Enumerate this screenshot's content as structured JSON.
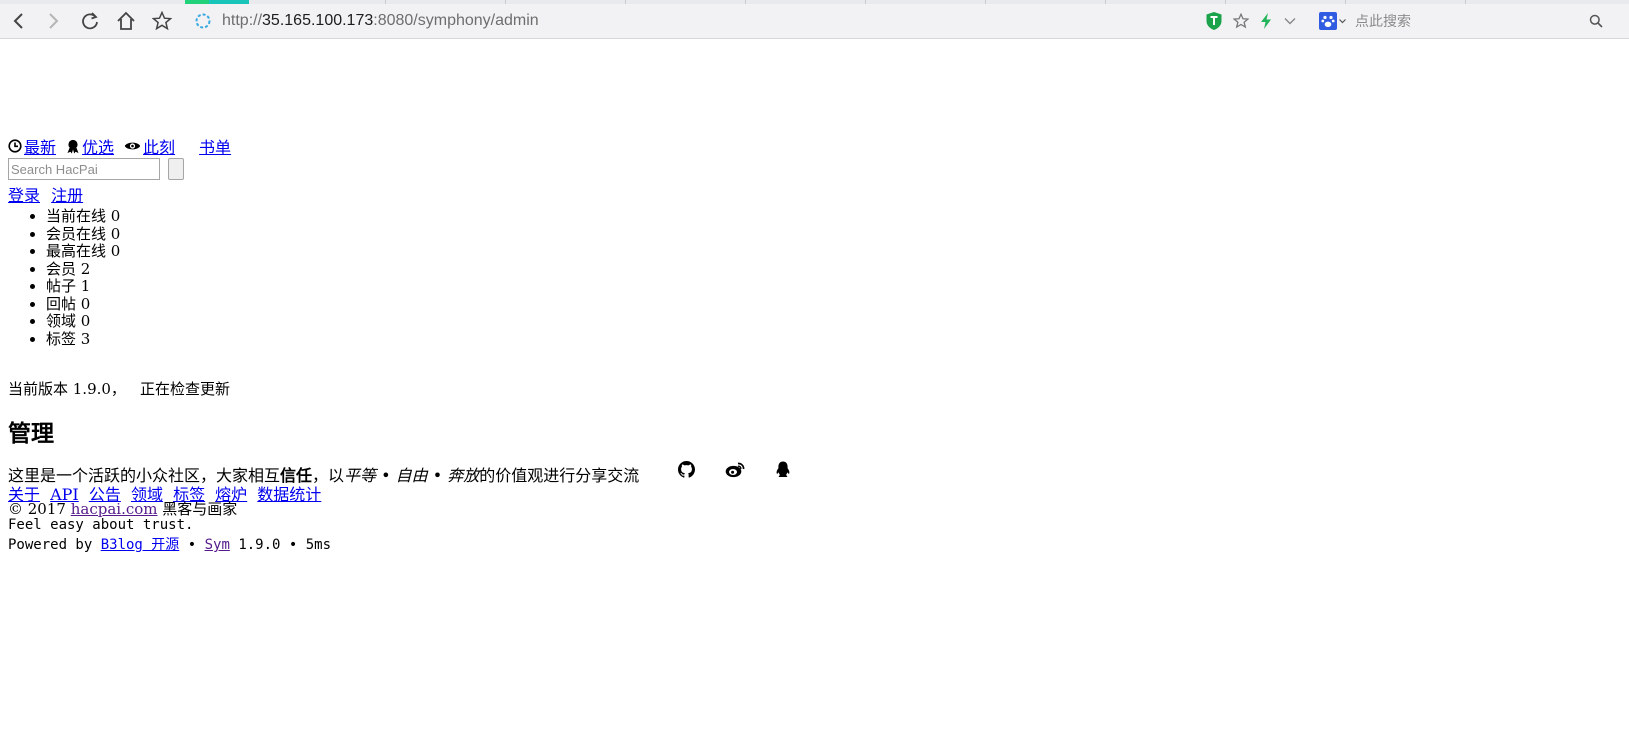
{
  "browser": {
    "url_scheme": "http://",
    "url_host": "35.165.100.173",
    "url_path": ":8080/symphony/admin",
    "search_placeholder": "点此搜索"
  },
  "nav": {
    "items": [
      {
        "label": " 最新",
        "icon": "clock-icon"
      },
      {
        "label": " 优选",
        "icon": "award-icon"
      },
      {
        "label": " 此刻",
        "icon": "eye-icon"
      },
      {
        "label": "书单",
        "icon": "book-icon"
      }
    ]
  },
  "search": {
    "placeholder": "Search HacPai"
  },
  "auth": {
    "login": "登录",
    "register": "注册"
  },
  "stats": [
    "当前在线 0",
    "会员在线 0",
    "最高在线 0",
    "会员 2",
    "帖子 1",
    "回帖 0",
    "领域 0",
    "标签 3"
  ],
  "version": {
    "text": "当前版本 1.9.0，",
    "status": "正在检查更新"
  },
  "heading": "管理",
  "slogan": {
    "prefix": "这里是一个活跃的小众社区，大家相互",
    "bold": "信任",
    "middle": "，以",
    "italic": "平等 • 自由 • 奔放",
    "suffix": "的价值观进行分享交流"
  },
  "social_icons": [
    "github-icon",
    "weibo-icon",
    "qq-icon"
  ],
  "footer_links": [
    "关于",
    "API",
    "公告",
    "领域",
    "标签",
    "熔炉",
    "数据统计"
  ],
  "copyright": {
    "prefix": "© 2017 ",
    "link": "hacpai.com",
    "suffix": " 黑客与画家"
  },
  "tagline": "Feel easy about trust.",
  "powered": {
    "prefix": "Powered by ",
    "b3log": "B3log 开源",
    "sep1": " • ",
    "sym": "Sym",
    "version": " 1.9.0 • 5ms"
  }
}
